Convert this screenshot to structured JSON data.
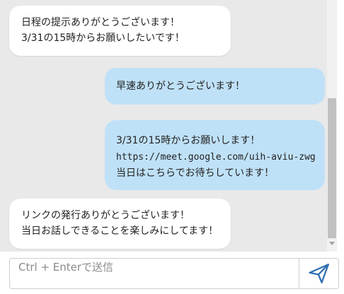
{
  "messages": [
    {
      "direction": "incoming",
      "lines": [
        "日程の提示ありがとうございます！",
        "3/31の15時からお願いしたいです！"
      ]
    },
    {
      "direction": "outgoing",
      "lines": [
        "早速ありがとうございます！"
      ]
    },
    {
      "direction": "outgoing",
      "lines": [
        "3/31の15時からお願いします！",
        "https://meet.google.com/uih-aviu-zwg",
        "当日はこちらでお待ちしています！"
      ]
    },
    {
      "direction": "incoming",
      "lines": [
        "リンクの発行ありがとうございます！",
        "当日お話しできることを楽しみにしてます！"
      ]
    }
  ],
  "composer": {
    "placeholder": "Ctrl + Enterで送信",
    "value": "",
    "send_icon": "paper-plane-icon"
  },
  "colors": {
    "chat_background": "#e9e9e9",
    "incoming_bubble": "#ffffff",
    "outgoing_bubble": "#bfe1f7",
    "send_icon": "#2f6fb3"
  }
}
